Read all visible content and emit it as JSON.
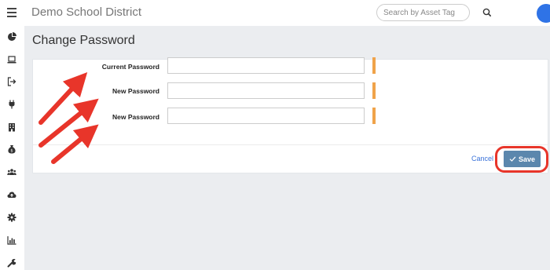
{
  "header": {
    "app_title": "Demo School District",
    "search_placeholder": "Search by Asset Tag"
  },
  "sidebar": {
    "items": [
      {
        "icon": "pie-chart-icon"
      },
      {
        "icon": "laptop-icon"
      },
      {
        "icon": "sign-out-icon"
      },
      {
        "icon": "plug-icon"
      },
      {
        "icon": "building-icon"
      },
      {
        "icon": "money-bag-icon"
      },
      {
        "icon": "users-icon"
      },
      {
        "icon": "cloud-upload-icon"
      },
      {
        "icon": "gear-icon"
      },
      {
        "icon": "bar-chart-icon"
      },
      {
        "icon": "wrench-icon"
      }
    ]
  },
  "page": {
    "title": "Change Password"
  },
  "form": {
    "fields": [
      {
        "label": "Current Password",
        "value": ""
      },
      {
        "label": "New Password",
        "value": ""
      },
      {
        "label": "New Password",
        "value": ""
      }
    ],
    "cancel_label": "Cancel",
    "save_label": "Save"
  },
  "colors": {
    "accent": "#2f73e6",
    "save_button": "#5b87ad",
    "required_marker": "#f0a34a",
    "annotation": "#e8352a"
  }
}
